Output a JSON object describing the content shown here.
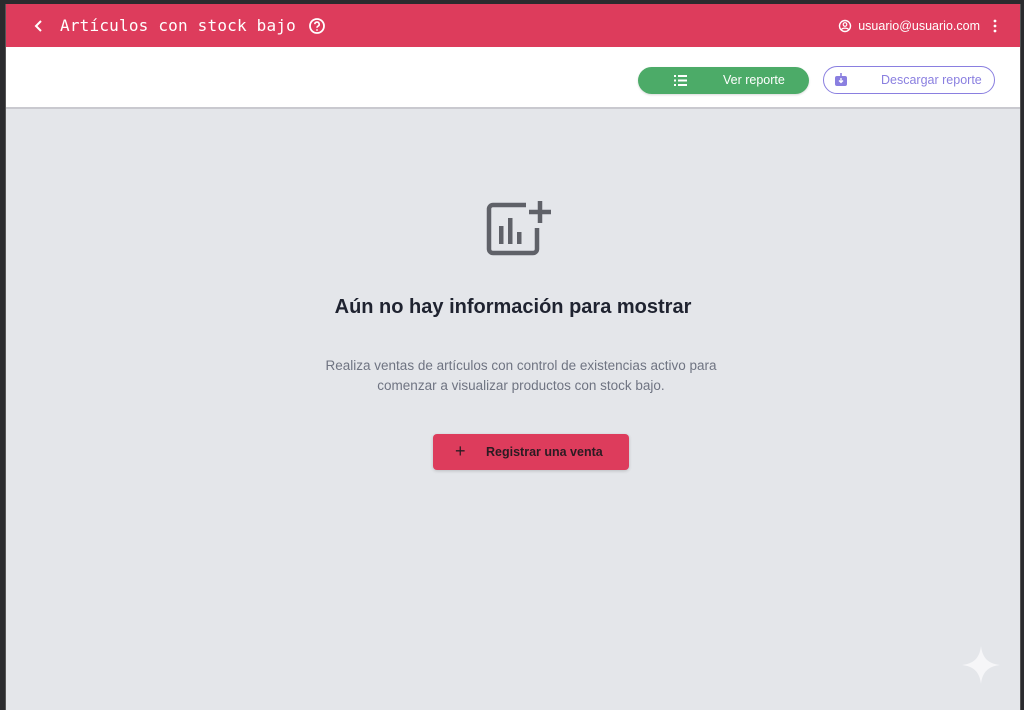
{
  "header": {
    "title": "Artículos con stock bajo",
    "user_email": "usuario@usuario.com"
  },
  "toolbar": {
    "view_report_label": "Ver reporte",
    "download_report_label": "Descargar reporte"
  },
  "empty_state": {
    "heading": "Aún no hay información para mostrar",
    "description_line1": "Realiza ventas de artículos con control de existencias activo para",
    "description_line2": "comenzar a visualizar productos con stock bajo.",
    "cta_label": "Registrar una venta",
    "cta_icon": "+"
  },
  "icons": {
    "back": "chevron-left-icon",
    "help": "help-circle-icon",
    "user": "user-icon",
    "menu": "kebab-menu-icon",
    "list": "list-icon",
    "download": "download-icon",
    "empty": "chart-add-icon",
    "plus": "plus-icon"
  },
  "colors": {
    "brand": "#dd3c5c",
    "success": "#4cab68",
    "accent": "#8a7fe0",
    "background": "#e4e6ea"
  }
}
